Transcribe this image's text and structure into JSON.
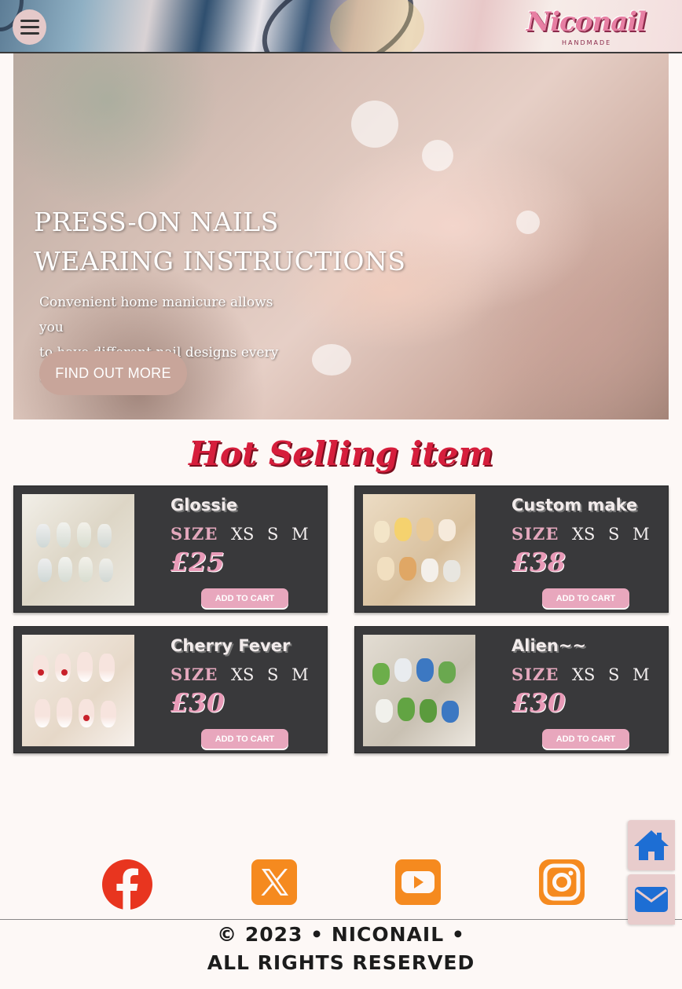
{
  "header": {
    "menu_icon": "hamburger-icon",
    "logo_text": "Niconail",
    "logo_sub": "HANDMADE"
  },
  "hero": {
    "title_line1": "PRESS-ON NAILS",
    "title_line2": "WEARING INSTRUCTIONS",
    "sub_line1": "Convenient home manicure allows you",
    "sub_line2": "to have different nail designs every day",
    "button_label": "FIND OUT MORE"
  },
  "section": {
    "title": "Hot Selling item"
  },
  "products": [
    {
      "name": "Glossie",
      "size_label": "SIZE",
      "sizes": [
        "XS",
        "S",
        "M"
      ],
      "price": "£25",
      "cart_label": "ADD TO CART"
    },
    {
      "name": "Custom make",
      "size_label": "SIZE",
      "sizes": [
        "XS",
        "S",
        "M"
      ],
      "price": "£38",
      "cart_label": "ADD TO CART"
    },
    {
      "name": "Cherry Fever",
      "size_label": "SIZE",
      "sizes": [
        "XS",
        "S",
        "M"
      ],
      "price": "£30",
      "cart_label": "ADD TO CART"
    },
    {
      "name": "Alien~~",
      "size_label": "SIZE",
      "sizes": [
        "XS",
        "S",
        "M"
      ],
      "price": "£30",
      "cart_label": "ADD TO CART"
    }
  ],
  "social": {
    "icons": [
      "facebook-icon",
      "x-icon",
      "youtube-icon",
      "instagram-icon"
    ],
    "facebook_color": "#e8351f",
    "other_color": "#f58a1f"
  },
  "footer": {
    "line1": "© 2023 • NICONAIL •",
    "line2": "ALL RIGHTS RESERVED"
  },
  "floating": {
    "home_icon": "home-icon",
    "mail_icon": "envelope-icon",
    "icon_color": "#1d6ed4"
  }
}
